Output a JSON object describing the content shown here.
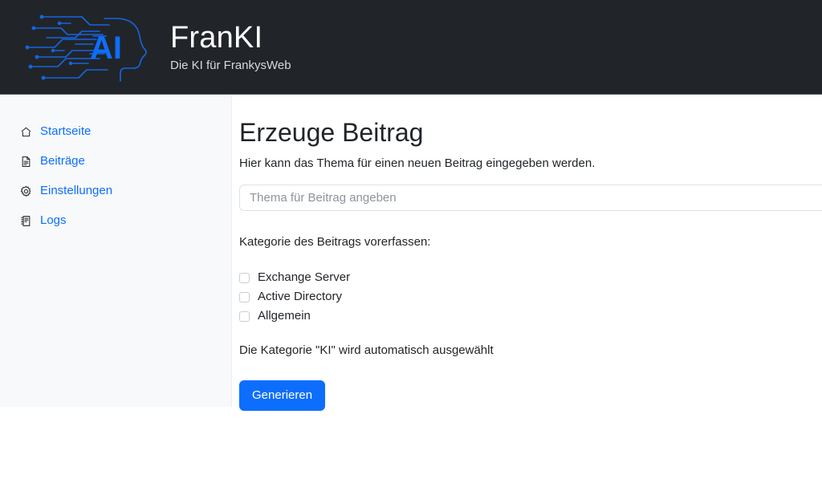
{
  "header": {
    "logo_icon": "ai-circuit-head-logo",
    "logo_text": "AI",
    "title": "FranKI",
    "subtitle": "Die KI für FrankysWeb",
    "background_color": "#212529"
  },
  "sidebar": {
    "background_color": "#f8f9fa",
    "link_color": "#0d6efd",
    "items": [
      {
        "label": "Startseite",
        "icon": "home-icon"
      },
      {
        "label": "Beiträge",
        "icon": "file-text-icon"
      },
      {
        "label": "Einstellungen",
        "icon": "gear-icon"
      },
      {
        "label": "Logs",
        "icon": "journal-icon"
      }
    ]
  },
  "main": {
    "title": "Erzeuge Beitrag",
    "lead": "Hier kann das Thema für einen neuen Beitrag eingegeben werden.",
    "topic_input": {
      "placeholder": "Thema für Beitrag angeben",
      "value": ""
    },
    "category_label": "Kategorie des Beitrags vorerfassen:",
    "categories": [
      {
        "label": "Exchange Server",
        "checked": false
      },
      {
        "label": "Active Directory",
        "checked": false
      },
      {
        "label": "Allgemein",
        "checked": false
      }
    ],
    "note": "Die Kategorie \"KI\" wird automatisch ausgewählt",
    "submit_label": "Generieren",
    "accent_color": "#0d6efd"
  }
}
